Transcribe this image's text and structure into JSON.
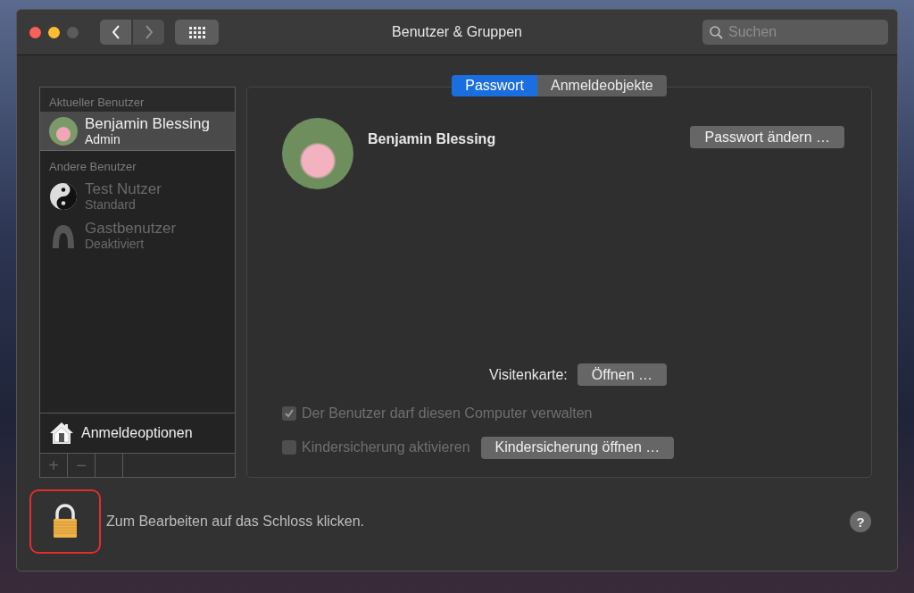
{
  "window": {
    "title": "Benutzer & Gruppen"
  },
  "toolbar": {
    "back": {
      "disabled": false
    },
    "forward": {
      "disabled": true
    },
    "search": {
      "placeholder": "Suchen"
    }
  },
  "sidebar": {
    "sections": [
      {
        "heading": "Aktueller Benutzer",
        "users": [
          {
            "name": "Benjamin Blessing",
            "role": "Admin",
            "kind": "photo",
            "selected": true,
            "disabled": false
          }
        ]
      },
      {
        "heading": "Andere Benutzer",
        "users": [
          {
            "name": "Test Nutzer",
            "role": "Standard",
            "kind": "yinyang",
            "selected": false,
            "disabled": true
          },
          {
            "name": "Gastbenutzer",
            "role": "Deaktiviert",
            "kind": "guest",
            "selected": false,
            "disabled": true
          }
        ]
      }
    ],
    "login_options": "Anmeldeoptionen",
    "footer_buttons": [
      {
        "label": "+",
        "disabled": true
      },
      {
        "label": "−",
        "disabled": true
      }
    ]
  },
  "tabs": [
    {
      "label": "Passwort",
      "selected": true
    },
    {
      "label": "Anmeldeobjekte",
      "selected": false
    }
  ],
  "panel": {
    "user_name": "Benjamin Blessing",
    "change_password": "Passwort ändern …",
    "business_card": {
      "label": "Visitenkarte:",
      "button": "Öffnen …"
    },
    "checkboxes": [
      {
        "label": "Der Benutzer darf diesen Computer verwalten",
        "checked": true,
        "disabled": true
      },
      {
        "label": "Kindersicherung aktivieren",
        "checked": false,
        "disabled": true,
        "button": "Kindersicherung öffnen …"
      }
    ]
  },
  "lock": {
    "message": "Zum Bearbeiten auf das Schloss klicken.",
    "highlighted": true
  },
  "help": "?"
}
